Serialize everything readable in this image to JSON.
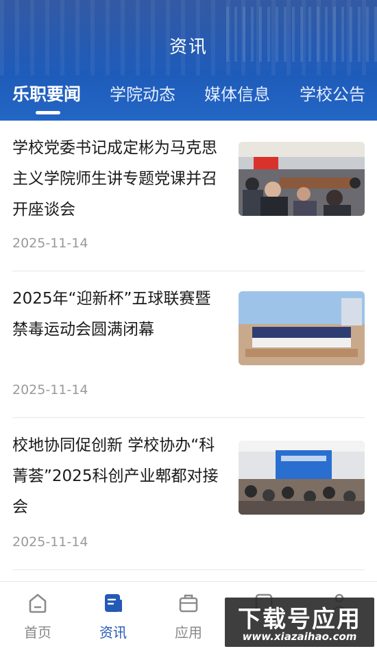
{
  "header": {
    "title": "资讯",
    "tabs": [
      {
        "label": "乐职要闻",
        "active": true
      },
      {
        "label": "学院动态",
        "active": false
      },
      {
        "label": "媒体信息",
        "active": false
      },
      {
        "label": "学校公告",
        "active": false
      }
    ]
  },
  "news": [
    {
      "title": "学校党委书记成定彬为马克思主义学院师生讲专题党课并召开座谈会",
      "date": "2025-11-14",
      "thumb": "meeting-room-photo"
    },
    {
      "title": "2025年“迎新杯”五球联赛暨禁毒运动会圆满闭幕",
      "date": "2025-11-14",
      "thumb": "sports-group-photo"
    },
    {
      "title": "校地协同促创新 学校协办“科菁荟”2025科创产业郫都对接会",
      "date": "2025-11-14",
      "thumb": "conference-hall-photo"
    }
  ],
  "tabbar": [
    {
      "label": "首页",
      "icon": "home-icon",
      "active": false
    },
    {
      "label": "资讯",
      "icon": "news-icon",
      "active": true
    },
    {
      "label": "应用",
      "icon": "briefcase-icon",
      "active": false
    },
    {
      "label": "",
      "icon": "message-icon",
      "active": false
    },
    {
      "label": "",
      "icon": "profile-icon",
      "active": false
    }
  ],
  "watermark": {
    "main": "下载号应用",
    "sub": "www.xiazaihao.com"
  },
  "colors": {
    "header": "#1e5ab8",
    "accent": "#2459b5",
    "date": "#999999"
  }
}
